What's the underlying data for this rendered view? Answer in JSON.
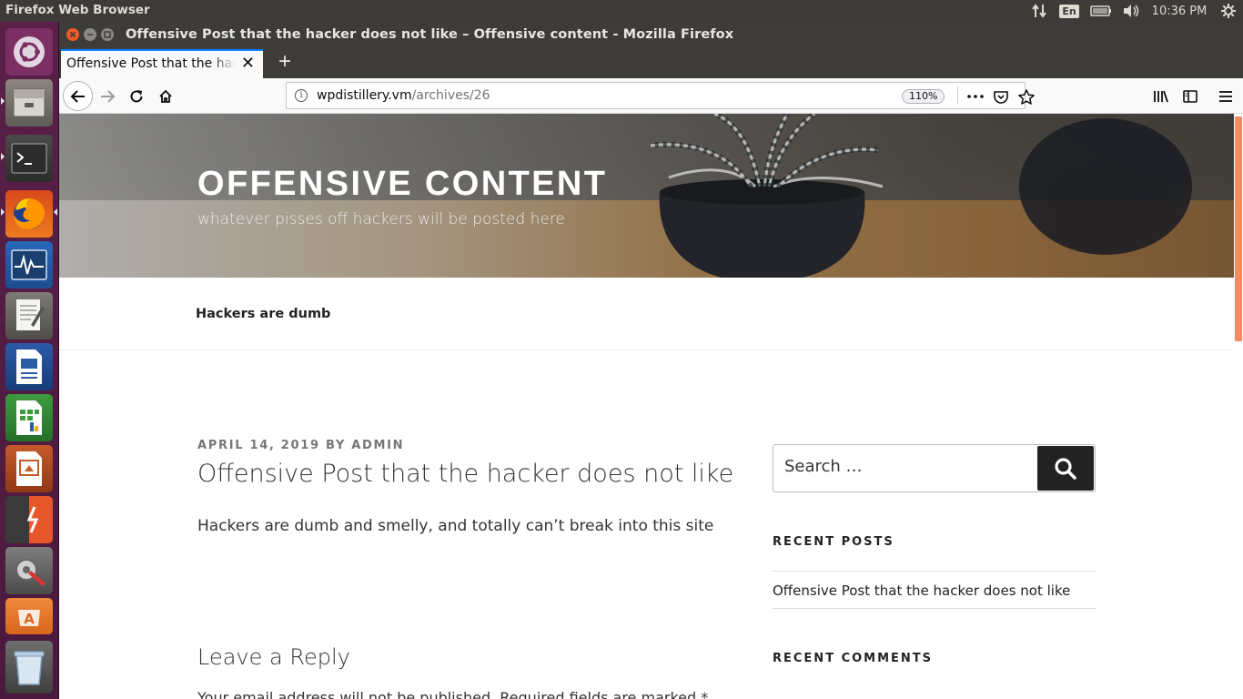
{
  "top_panel": {
    "app_name": "Firefox Web Browser",
    "keyboard_layout": "En",
    "time": "10:36 PM"
  },
  "launcher": {
    "items": [
      {
        "name": "ubuntu-dash-icon"
      },
      {
        "name": "files-icon"
      },
      {
        "name": "terminal-icon"
      },
      {
        "name": "firefox-icon"
      },
      {
        "name": "system-monitor-icon"
      },
      {
        "name": "text-editor-icon"
      },
      {
        "name": "writer-icon"
      },
      {
        "name": "calc-icon"
      },
      {
        "name": "impress-icon"
      },
      {
        "name": "app-icon"
      },
      {
        "name": "settings-icon"
      },
      {
        "name": "software-center-icon"
      },
      {
        "name": "trash-icon"
      }
    ]
  },
  "window": {
    "title": "Offensive Post that the hacker does not like – Offensive content - Mozilla Firefox",
    "tab_label": "Offensive Post that the hacker does not like – Offensive content"
  },
  "urlbar": {
    "host": "wpdistillery.vm",
    "path": "/archives/26",
    "zoom": "110%"
  },
  "page": {
    "site_title": "OFFENSIVE CONTENT",
    "site_description": "whatever pisses off hackers will be posted here",
    "nav_item": "Hackers are dumb",
    "entry_meta": "APRIL 14, 2019 BY ADMIN",
    "entry_title": "Offensive Post that the hacker does not like",
    "entry_content": "Hackers are dumb and smelly, and totally can’t break into this site",
    "reply_title": "Leave a Reply",
    "reply_notes": "Your email address will not be published. Required fields are marked *"
  },
  "sidebar": {
    "search_placeholder": "Search …",
    "recent_posts_title": "RECENT POSTS",
    "recent_posts": [
      "Offensive Post that the hacker does not like"
    ],
    "recent_comments_title": "RECENT COMMENTS"
  },
  "colors": {
    "launcher_bg": "#5a2048",
    "accent_scrollbar": "#f28a62",
    "tab_highlight": "#0a84ff"
  }
}
